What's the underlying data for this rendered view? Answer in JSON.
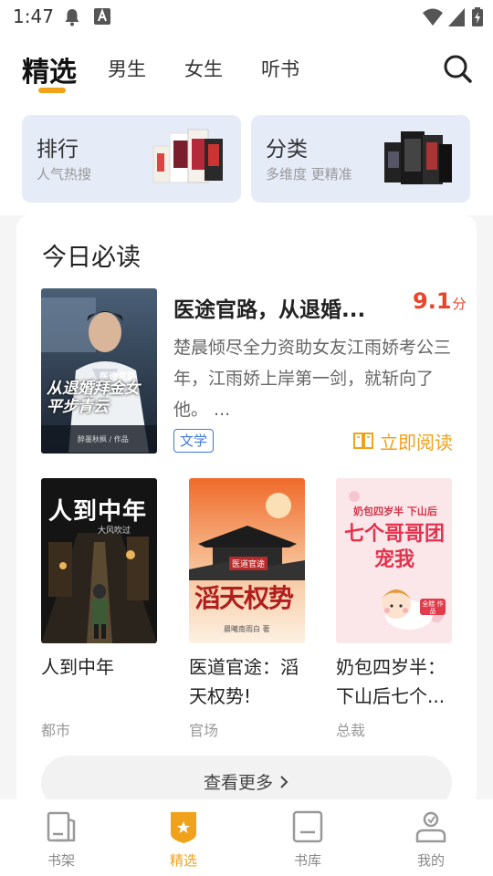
{
  "status_bar": {
    "time": "1:47"
  },
  "header": {
    "tabs": [
      {
        "label": "精选",
        "active": true
      },
      {
        "label": "男生",
        "active": false
      },
      {
        "label": "女生",
        "active": false
      },
      {
        "label": "听书",
        "active": false
      }
    ],
    "accent_color": "#f0a21a"
  },
  "quick_cards": [
    {
      "title": "排行",
      "subtitle": "人气热搜"
    },
    {
      "title": "分类",
      "subtitle": "多维度 更精准"
    }
  ],
  "daily": {
    "section_title": "今日必读",
    "featured": {
      "title": "医途官路，从退婚...",
      "score": "9.1",
      "score_unit": "分",
      "description": "楚晨倾尽全力资助女友江雨娇考公三年，江雨娇上岸第一剑，就斩向了他。 ...",
      "tag": "文学",
      "read_label": "立即阅读",
      "cover_text": {
        "series": "医途官路",
        "main": "从退婚拜金女平步青云",
        "author": "醉墨秋枫 / 作品"
      }
    },
    "books": [
      {
        "title": "人到中年",
        "category": "都市",
        "cover_text": {
          "main": "人到中年",
          "author": "大风吹过"
        }
      },
      {
        "title": "医道官途：滔天权势!",
        "category": "官场",
        "cover_text": {
          "series": "医道官途",
          "main": "滔天权势",
          "author": "晨曦南雨白 著"
        }
      },
      {
        "title": "奶包四岁半：下山后七个...",
        "category": "总裁",
        "cover_text": {
          "top": "奶包四岁半 下山后",
          "main": "七个哥哥团宠我",
          "badge": "全糕 作品"
        }
      }
    ],
    "more_label": "查看更多"
  },
  "bottom_nav": [
    {
      "label": "书架",
      "icon": "bookshelf-icon",
      "active": false
    },
    {
      "label": "精选",
      "icon": "featured-star-icon",
      "active": true
    },
    {
      "label": "书库",
      "icon": "library-icon",
      "active": false
    },
    {
      "label": "我的",
      "icon": "profile-icon",
      "active": false
    }
  ]
}
